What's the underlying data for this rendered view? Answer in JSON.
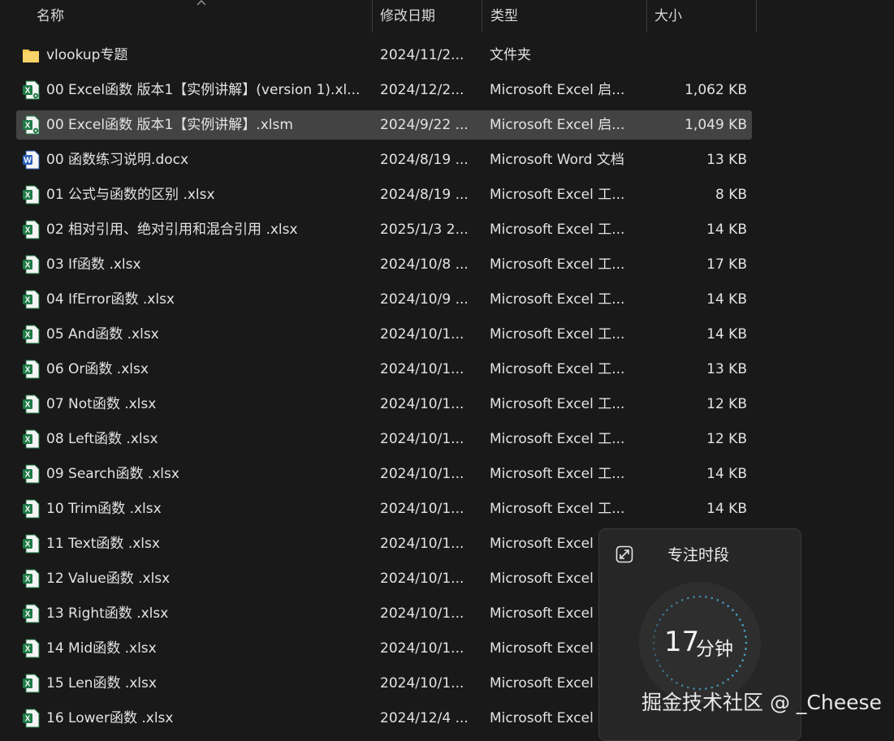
{
  "columns": {
    "name": "名称",
    "date": "修改日期",
    "type": "类型",
    "size": "大小"
  },
  "files": [
    {
      "name": "vlookup专题",
      "date": "2024/11/2...",
      "type": "文件夹",
      "size": "",
      "icon": "folder-icon",
      "selected": false
    },
    {
      "name": "00 Excel函数 版本1【实例讲解】(version 1).xl...",
      "date": "2024/12/2...",
      "type": "Microsoft Excel 启...",
      "size": "1,062 KB",
      "icon": "excel-macro-file-icon",
      "selected": false
    },
    {
      "name": "00 Excel函数 版本1【实例讲解】.xlsm",
      "date": "2024/9/22 ...",
      "type": "Microsoft Excel 启...",
      "size": "1,049 KB",
      "icon": "excel-macro-file-icon",
      "selected": true
    },
    {
      "name": "00 函数练习说明.docx",
      "date": "2024/8/19 ...",
      "type": "Microsoft Word 文档",
      "size": "13 KB",
      "icon": "word-file-icon",
      "selected": false
    },
    {
      "name": "01  公式与函数的区别 .xlsx",
      "date": "2024/8/19 ...",
      "type": "Microsoft Excel 工...",
      "size": "8 KB",
      "icon": "excel-file-icon",
      "selected": false
    },
    {
      "name": "02  相对引用、绝对引用和混合引用 .xlsx",
      "date": "2025/1/3 2...",
      "type": "Microsoft Excel 工...",
      "size": "14 KB",
      "icon": "excel-file-icon",
      "selected": false
    },
    {
      "name": "03  If函数 .xlsx",
      "date": "2024/10/8 ...",
      "type": "Microsoft Excel 工...",
      "size": "17 KB",
      "icon": "excel-file-icon",
      "selected": false
    },
    {
      "name": "04  IfError函数 .xlsx",
      "date": "2024/10/9 ...",
      "type": "Microsoft Excel 工...",
      "size": "14 KB",
      "icon": "excel-file-icon",
      "selected": false
    },
    {
      "name": "05  And函数 .xlsx",
      "date": "2024/10/1...",
      "type": "Microsoft Excel 工...",
      "size": "14 KB",
      "icon": "excel-file-icon",
      "selected": false
    },
    {
      "name": "06  Or函数 .xlsx",
      "date": "2024/10/1...",
      "type": "Microsoft Excel 工...",
      "size": "13 KB",
      "icon": "excel-file-icon",
      "selected": false
    },
    {
      "name": "07  Not函数 .xlsx",
      "date": "2024/10/1...",
      "type": "Microsoft Excel 工...",
      "size": "12 KB",
      "icon": "excel-file-icon",
      "selected": false
    },
    {
      "name": "08  Left函数 .xlsx",
      "date": "2024/10/1...",
      "type": "Microsoft Excel 工...",
      "size": "12 KB",
      "icon": "excel-file-icon",
      "selected": false
    },
    {
      "name": "09  Search函数 .xlsx",
      "date": "2024/10/1...",
      "type": "Microsoft Excel 工...",
      "size": "14 KB",
      "icon": "excel-file-icon",
      "selected": false
    },
    {
      "name": "10 Trim函数 .xlsx",
      "date": "2024/10/1...",
      "type": "Microsoft Excel 工...",
      "size": "14 KB",
      "icon": "excel-file-icon",
      "selected": false
    },
    {
      "name": "11 Text函数 .xlsx",
      "date": "2024/10/1...",
      "type": "Microsoft Excel",
      "size": "",
      "icon": "excel-file-icon",
      "selected": false
    },
    {
      "name": "12 Value函数 .xlsx",
      "date": "2024/10/1...",
      "type": "Microsoft Excel",
      "size": "",
      "icon": "excel-file-icon",
      "selected": false
    },
    {
      "name": "13  Right函数 .xlsx",
      "date": "2024/10/1...",
      "type": "Microsoft Excel",
      "size": "",
      "icon": "excel-file-icon",
      "selected": false
    },
    {
      "name": "14  Mid函数 .xlsx",
      "date": "2024/10/1...",
      "type": "Microsoft Excel",
      "size": "",
      "icon": "excel-file-icon",
      "selected": false
    },
    {
      "name": "15  Len函数 .xlsx",
      "date": "2024/10/1...",
      "type": "Microsoft Excel",
      "size": "",
      "icon": "excel-file-icon",
      "selected": false
    },
    {
      "name": "16  Lower函数 .xlsx",
      "date": "2024/12/4 ...",
      "type": "Microsoft Excel",
      "size": "",
      "icon": "excel-file-icon",
      "selected": false
    }
  ],
  "focus_panel": {
    "title": "专注时段",
    "minutes": "17",
    "unit": "分钟"
  },
  "watermark": "掘金技术社区 @ _Cheese",
  "colors": {
    "background": "#191919",
    "selected_row": "#434343",
    "excel_green": "#1e7a45",
    "word_blue": "#2b5fb8",
    "folder_yellow": "#f2c649",
    "timer_dot": "#4aa3c8"
  }
}
